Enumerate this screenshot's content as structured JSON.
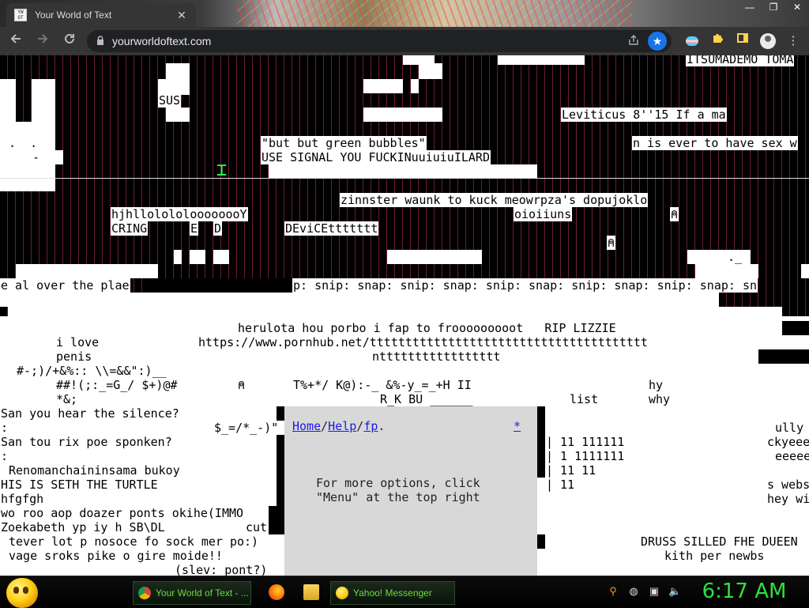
{
  "browser": {
    "tab_title": "Your World of Text",
    "tab_close": "✕",
    "favicon_text": "YW\nOT",
    "url": "yourworldoftext.com",
    "window_controls": [
      "—",
      "❐",
      "✕"
    ],
    "icons": {
      "back": "arrow-left-icon",
      "forward": "arrow-right-icon",
      "reload": "reload-icon",
      "lock": "lock-icon",
      "share": "share-icon",
      "bookmark": "star-icon"
    },
    "accent": "#1a73e8"
  },
  "page": {
    "texts": [
      "ITSUMADEMO TOMA",
      "SUS",
      "Leviticus 8''15 If a ma",
      ".  .",
      "-",
      "\"but but green bubbles\"",
      "n is ever to have sex w",
      "USE SIGNAL YOU FUCKINuuiuiuILARD",
      "zinnster waunk to kuck meowrpza's dopujoklo",
      "hjhllolololoooooooY",
      "oioiiuns",
      "CRING",
      "E",
      "D",
      "DEviCEttttttt",
      "._",
      "e al over the plae",
      "p: snip: snap: snip: snap: snip: snap: snip: snap: snip: snap: sn",
      "herulota hou porbo i fap to frooooooooot   RIP LIZZIE",
      "i love",
      "https://www.pornhub.net/ttttttttttttttttttttttttttttttttttttttt",
      "penis",
      "nttttttttttttttttt",
      "#-;)/+&%:: \\\\=&&\":)__",
      "##!(;:_=G_/ $+)@#",
      "T%+*/ K@):-_ &%-y_=_+H II",
      "hy",
      "*&;",
      "R_K BU ______",
      "list",
      "why",
      "San you hear the silence?",
      ":",
      "$_=/*_-)\"",
      "San tou rix poe sponken?",
      ":",
      "Renomanchaininsama bukoy",
      "HIS IS SETH THE TURTLE",
      "hfgfgh",
      "wo roo aop doazer ponts okihe(IMMO",
      "Zoekabeth yp iy h SB\\DL",
      "cut",
      "tever lot p nosoce fo sock mer po:)",
      "vage sroks pike o gire moide!!",
      "(slev: pont?)",
      "| 11 111111",
      "| 1 1111111",
      "| 11 11",
      "| 11",
      "ully",
      "ckyeee",
      "eeeee",
      "s webs",
      "hey wi",
      "DRUSS SILLED FHE DUEEN",
      "kith per newbs"
    ],
    "symbol": "⍝"
  },
  "menu": {
    "home": "Home",
    "help": "Help",
    "fp": "fp",
    "sep": "/",
    "dot": ".",
    "close": "*",
    "info_line1": "For more options, click",
    "info_line2": "\"Menu\" at the top right"
  },
  "taskbar": {
    "start_icon": "smiley-orb-icon",
    "tasks": [
      {
        "label": "Your World of Text - ...",
        "icon": "chrome-icon"
      },
      {
        "label": "Yahoo! Messenger",
        "icon": "yahoo-messenger-icon"
      }
    ],
    "quick_launch": [
      "firefox-icon",
      "folder-icon"
    ],
    "tray": [
      "search-icon",
      "circle-icon",
      "network-icon",
      "volume-icon"
    ],
    "clock": "6:17 AM",
    "clock_color": "#2fe03a"
  }
}
